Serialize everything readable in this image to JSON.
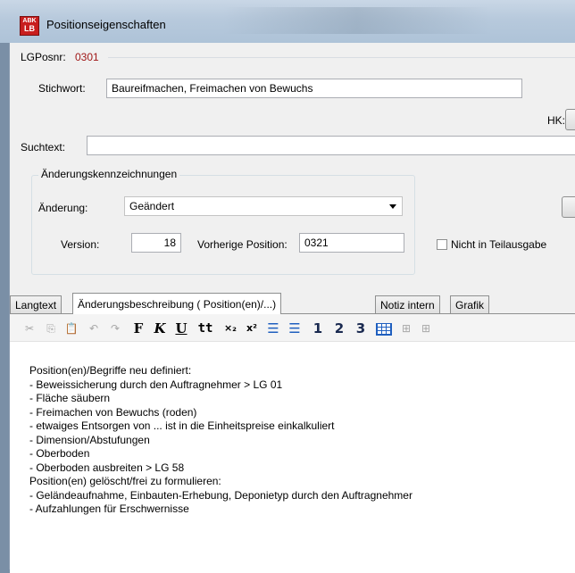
{
  "window": {
    "title": "Positionseigenschaften",
    "app_icon_text_top": "ABK",
    "app_icon_text_bottom": "LB"
  },
  "form": {
    "lgposnr_label": "LGPosnr:",
    "lgposnr_value": "0301",
    "stichwort_label": "Stichwort:",
    "stichwort_value": "Baureifmachen, Freimachen von Bewuchs",
    "hk_label": "HK:",
    "suchtext_label": "Suchtext:",
    "suchtext_value": ""
  },
  "changes": {
    "group_title": "Änderungskennzeichnungen",
    "aenderung_label": "Änderung:",
    "aenderung_value": "Geändert",
    "version_label": "Version:",
    "version_value": "18",
    "vorherige_label": "Vorherige Position:",
    "vorherige_value": "0321",
    "teilausgabe_label": "Nicht in Teilausgabe"
  },
  "tabs": [
    {
      "label": "Langtext"
    },
    {
      "label": "Änderungsbeschreibung ( Position(en)/...)"
    },
    {
      "label": "Notiz intern"
    },
    {
      "label": "Grafik"
    }
  ],
  "toolbar": {
    "bold": "F",
    "italic": "K",
    "underline": "U",
    "tt": "tt",
    "sub": "×₂",
    "sup": "x²",
    "h1": "1",
    "h2": "2",
    "h3": "3"
  },
  "editor_lines": [
    "Position(en)/Begriffe neu definiert:",
    "- Beweissicherung durch den Auftragnehmer > LG 01",
    "- Fläche säubern",
    "- Freimachen von Bewuchs (roden)",
    "- etwaiges Entsorgen von ... ist in die Einheitspreise einkalkuliert",
    "- Dimension/Abstufungen",
    "- Oberboden",
    "- Oberboden ausbreiten > LG 58",
    "Position(en) gelöscht/frei zu formulieren:",
    "- Geländeaufnahme, Einbauten-Erhebung, Deponietyp durch den Auftragnehmer",
    "- Aufzahlungen für Erschwernisse"
  ],
  "colors": {
    "lgposnr_value": "#a01818",
    "icon_red": "#c81e1e",
    "toolbar_blue": "#1f5fbf"
  }
}
